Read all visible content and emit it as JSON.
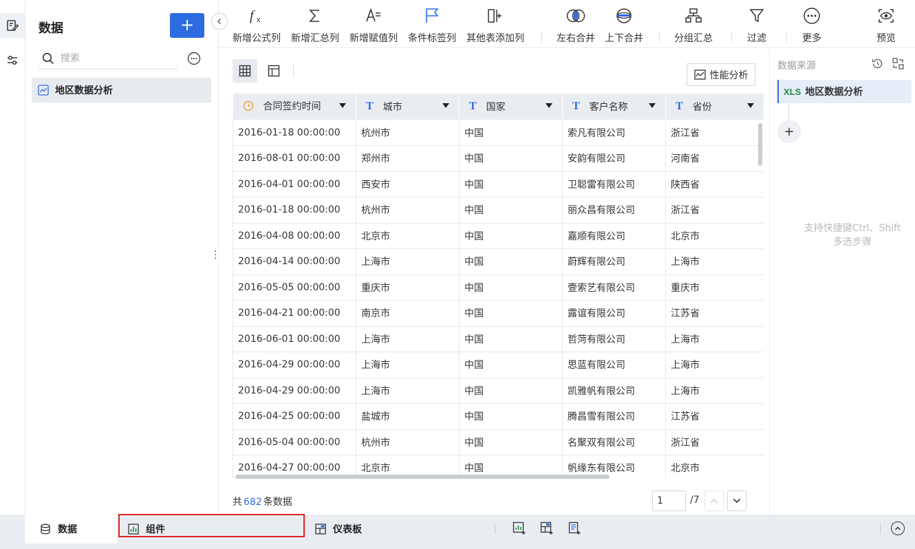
{
  "sidebar": {
    "title": "数据",
    "add_label": "+",
    "search_placeholder": "搜索",
    "items": [
      {
        "label": "地区数据分析"
      }
    ]
  },
  "toolbar": {
    "items": [
      {
        "label": "新增公式列",
        "icon": "formula-icon"
      },
      {
        "label": "新增汇总列",
        "icon": "sigma-icon"
      },
      {
        "label": "新增赋值列",
        "icon": "assign-icon"
      },
      {
        "label": "条件标签列",
        "icon": "flag-icon"
      },
      {
        "label": "其他表添加列",
        "icon": "add-column-icon"
      },
      {
        "label": "左右合并",
        "icon": "merge-horizontal-icon"
      },
      {
        "label": "上下合并",
        "icon": "merge-vertical-icon"
      },
      {
        "label": "分组汇总",
        "icon": "group-summary-icon"
      },
      {
        "label": "过滤",
        "icon": "filter-icon"
      },
      {
        "label": "更多",
        "icon": "more-icon"
      },
      {
        "label": "预览",
        "icon": "preview-icon"
      }
    ]
  },
  "main": {
    "perf_label": "性能分析",
    "columns": [
      {
        "label": "合同签约时间",
        "type": "date"
      },
      {
        "label": "城市",
        "type": "text"
      },
      {
        "label": "国家",
        "type": "text"
      },
      {
        "label": "客户名称",
        "type": "text"
      },
      {
        "label": "省份",
        "type": "text"
      }
    ],
    "rows": [
      [
        "2016-01-18 00:00:00",
        "杭州市",
        "中国",
        "索凡有限公司",
        "浙江省"
      ],
      [
        "2016-08-01 00:00:00",
        "郑州市",
        "中国",
        "安韵有限公司",
        "河南省"
      ],
      [
        "2016-04-01 00:00:00",
        "西安市",
        "中国",
        "卫聪雷有限公司",
        "陕西省"
      ],
      [
        "2016-01-18 00:00:00",
        "杭州市",
        "中国",
        "丽众昌有限公司",
        "浙江省"
      ],
      [
        "2016-04-08 00:00:00",
        "北京市",
        "中国",
        "嘉顺有限公司",
        "北京市"
      ],
      [
        "2016-04-14 00:00:00",
        "上海市",
        "中国",
        "蔚辉有限公司",
        "上海市"
      ],
      [
        "2016-05-05 00:00:00",
        "重庆市",
        "中国",
        "壹索艺有限公司",
        "重庆市"
      ],
      [
        "2016-04-21 00:00:00",
        "南京市",
        "中国",
        "露谊有限公司",
        "江苏省"
      ],
      [
        "2016-06-01 00:00:00",
        "上海市",
        "中国",
        "哲菏有限公司",
        "上海市"
      ],
      [
        "2016-04-29 00:00:00",
        "上海市",
        "中国",
        "思蓝有限公司",
        "上海市"
      ],
      [
        "2016-04-29 00:00:00",
        "上海市",
        "中国",
        "凯雅帆有限公司",
        "上海市"
      ],
      [
        "2016-04-25 00:00:00",
        "盐城市",
        "中国",
        "腾昌雪有限公司",
        "江苏省"
      ],
      [
        "2016-05-04 00:00:00",
        "杭州市",
        "中国",
        "名聚双有限公司",
        "浙江省"
      ],
      [
        "2016-04-27 00:00:00",
        "北京市",
        "中国",
        "帆缘东有限公司",
        "北京市"
      ]
    ],
    "footer": {
      "prefix": "共",
      "count": "682",
      "suffix": "条数据",
      "page": "1",
      "total": "/7"
    }
  },
  "right_panel": {
    "title": "数据来源",
    "source_badge": "XLS",
    "source": "地区数据分析",
    "add_label": "+",
    "hint_line1": "支持快捷键Ctrl、Shift",
    "hint_line2": "多选步骤"
  },
  "bottom": {
    "tabs": [
      {
        "label": "数据",
        "icon": "database-icon"
      },
      {
        "label": "组件",
        "icon": "chart-component-icon"
      },
      {
        "label": "仪表板",
        "icon": "dashboard-icon"
      }
    ]
  },
  "colors": {
    "accent": "#2d6ce0",
    "highlight": "#e02020",
    "xls": "#1f8a3b",
    "date_icon": "#e8a33b"
  }
}
